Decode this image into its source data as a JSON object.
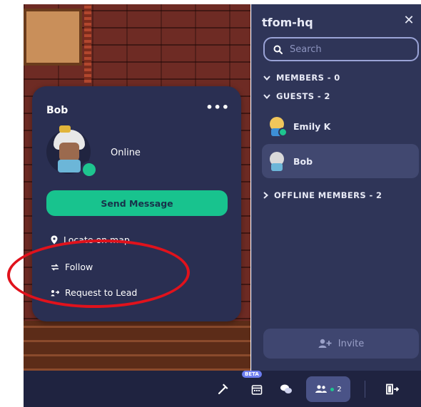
{
  "sidebar": {
    "title": "tfom-hq",
    "search_placeholder": "Search",
    "sections": {
      "members": "MEMBERS - 0",
      "guests": "GUESTS - 2",
      "offline": "OFFLINE MEMBERS - 2"
    },
    "guests": [
      {
        "name": "Emily K",
        "online": true
      },
      {
        "name": "Bob",
        "online": false,
        "selected": true
      }
    ],
    "invite_label": "Invite"
  },
  "profile_card": {
    "name": "Bob",
    "status": "Online",
    "send_message_label": "Send Message",
    "actions": {
      "locate": "Locate on map",
      "follow": "Follow",
      "lead": "Request to Lead"
    }
  },
  "bottom_bar": {
    "beta_badge": "BETA",
    "people_count": "2"
  },
  "colors": {
    "accent_green": "#18c38e",
    "panel_bg": "#2f3558",
    "card_bg": "#2a2f52",
    "annotation_red": "#e0121c"
  }
}
